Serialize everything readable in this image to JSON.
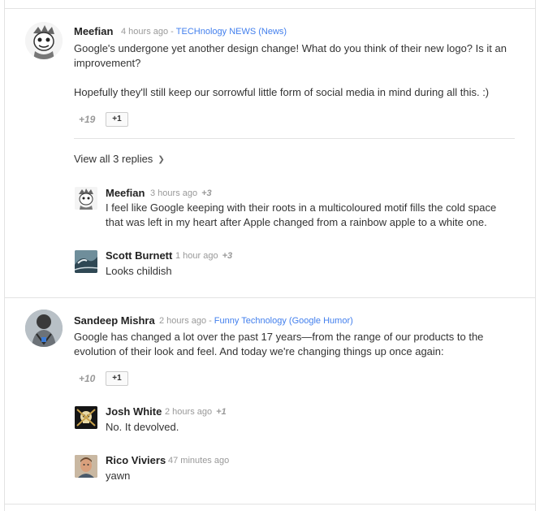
{
  "comments": [
    {
      "author": "Meefian",
      "time": "4 hours ago",
      "source": "TECHnology NEWS (News)",
      "text": "Google's undergone yet another design change! What do you think of their new logo? Is it an improvement?\n\nHopefully they'll still keep our sorrowful little form of social media in mind during all this. :)",
      "plus_count": "+19",
      "plus_button": "+1",
      "view_replies": "View all 3 replies",
      "replies": [
        {
          "author": "Meefian",
          "time": "3 hours ago",
          "plus": "+3",
          "text": "I feel like Google keeping with their roots in a multicoloured motif fills the cold space that was left in my heart after Apple changed from a rainbow apple to a white one."
        },
        {
          "author": "Scott Burnett",
          "time": "1 hour ago",
          "plus": "+3",
          "text": "Looks childish"
        }
      ]
    },
    {
      "author": "Sandeep Mishra",
      "time": "2 hours ago",
      "source": "Funny Technology (Google Humor)",
      "text": "Google has changed a lot over the past 17 years—from the range of our products to the evolution of their look and feel. And today we're changing things up once again:",
      "plus_count": "+10",
      "plus_button": "+1",
      "replies": [
        {
          "author": "Josh White",
          "time": "2 hours ago",
          "plus": "+1",
          "text": "No. It devolved."
        },
        {
          "author": "Rico Viviers",
          "time": "47 minutes ago",
          "plus": "",
          "text": "yawn"
        }
      ]
    }
  ],
  "meta_separator": "-",
  "icons": {
    "avatar_1": "cartoon-face-avatar",
    "avatar_2": "wave-photo-avatar",
    "avatar_3": "robot-man-avatar",
    "avatar_4": "skull-guns-avatar",
    "avatar_5": "man-portrait-avatar",
    "chevron": "chevron-down-icon"
  },
  "colors": {
    "link": "#427fed",
    "meta": "#999999",
    "divider": "#e3e3e3"
  }
}
